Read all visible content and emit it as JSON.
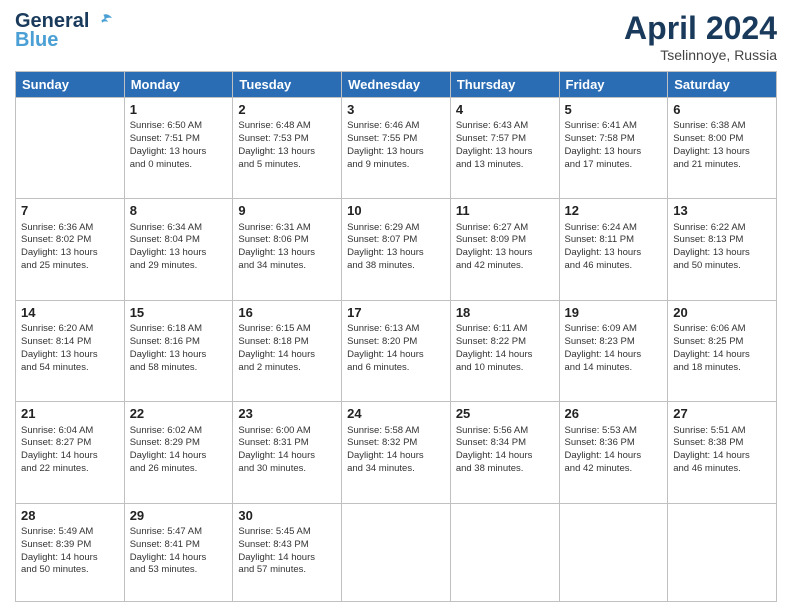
{
  "header": {
    "logo_line1": "General",
    "logo_line2": "Blue",
    "month": "April 2024",
    "location": "Tselinnoye, Russia"
  },
  "days_of_week": [
    "Sunday",
    "Monday",
    "Tuesday",
    "Wednesday",
    "Thursday",
    "Friday",
    "Saturday"
  ],
  "weeks": [
    [
      {
        "day": "",
        "content": ""
      },
      {
        "day": "1",
        "content": "Sunrise: 6:50 AM\nSunset: 7:51 PM\nDaylight: 13 hours\nand 0 minutes."
      },
      {
        "day": "2",
        "content": "Sunrise: 6:48 AM\nSunset: 7:53 PM\nDaylight: 13 hours\nand 5 minutes."
      },
      {
        "day": "3",
        "content": "Sunrise: 6:46 AM\nSunset: 7:55 PM\nDaylight: 13 hours\nand 9 minutes."
      },
      {
        "day": "4",
        "content": "Sunrise: 6:43 AM\nSunset: 7:57 PM\nDaylight: 13 hours\nand 13 minutes."
      },
      {
        "day": "5",
        "content": "Sunrise: 6:41 AM\nSunset: 7:58 PM\nDaylight: 13 hours\nand 17 minutes."
      },
      {
        "day": "6",
        "content": "Sunrise: 6:38 AM\nSunset: 8:00 PM\nDaylight: 13 hours\nand 21 minutes."
      }
    ],
    [
      {
        "day": "7",
        "content": "Sunrise: 6:36 AM\nSunset: 8:02 PM\nDaylight: 13 hours\nand 25 minutes."
      },
      {
        "day": "8",
        "content": "Sunrise: 6:34 AM\nSunset: 8:04 PM\nDaylight: 13 hours\nand 29 minutes."
      },
      {
        "day": "9",
        "content": "Sunrise: 6:31 AM\nSunset: 8:06 PM\nDaylight: 13 hours\nand 34 minutes."
      },
      {
        "day": "10",
        "content": "Sunrise: 6:29 AM\nSunset: 8:07 PM\nDaylight: 13 hours\nand 38 minutes."
      },
      {
        "day": "11",
        "content": "Sunrise: 6:27 AM\nSunset: 8:09 PM\nDaylight: 13 hours\nand 42 minutes."
      },
      {
        "day": "12",
        "content": "Sunrise: 6:24 AM\nSunset: 8:11 PM\nDaylight: 13 hours\nand 46 minutes."
      },
      {
        "day": "13",
        "content": "Sunrise: 6:22 AM\nSunset: 8:13 PM\nDaylight: 13 hours\nand 50 minutes."
      }
    ],
    [
      {
        "day": "14",
        "content": "Sunrise: 6:20 AM\nSunset: 8:14 PM\nDaylight: 13 hours\nand 54 minutes."
      },
      {
        "day": "15",
        "content": "Sunrise: 6:18 AM\nSunset: 8:16 PM\nDaylight: 13 hours\nand 58 minutes."
      },
      {
        "day": "16",
        "content": "Sunrise: 6:15 AM\nSunset: 8:18 PM\nDaylight: 14 hours\nand 2 minutes."
      },
      {
        "day": "17",
        "content": "Sunrise: 6:13 AM\nSunset: 8:20 PM\nDaylight: 14 hours\nand 6 minutes."
      },
      {
        "day": "18",
        "content": "Sunrise: 6:11 AM\nSunset: 8:22 PM\nDaylight: 14 hours\nand 10 minutes."
      },
      {
        "day": "19",
        "content": "Sunrise: 6:09 AM\nSunset: 8:23 PM\nDaylight: 14 hours\nand 14 minutes."
      },
      {
        "day": "20",
        "content": "Sunrise: 6:06 AM\nSunset: 8:25 PM\nDaylight: 14 hours\nand 18 minutes."
      }
    ],
    [
      {
        "day": "21",
        "content": "Sunrise: 6:04 AM\nSunset: 8:27 PM\nDaylight: 14 hours\nand 22 minutes."
      },
      {
        "day": "22",
        "content": "Sunrise: 6:02 AM\nSunset: 8:29 PM\nDaylight: 14 hours\nand 26 minutes."
      },
      {
        "day": "23",
        "content": "Sunrise: 6:00 AM\nSunset: 8:31 PM\nDaylight: 14 hours\nand 30 minutes."
      },
      {
        "day": "24",
        "content": "Sunrise: 5:58 AM\nSunset: 8:32 PM\nDaylight: 14 hours\nand 34 minutes."
      },
      {
        "day": "25",
        "content": "Sunrise: 5:56 AM\nSunset: 8:34 PM\nDaylight: 14 hours\nand 38 minutes."
      },
      {
        "day": "26",
        "content": "Sunrise: 5:53 AM\nSunset: 8:36 PM\nDaylight: 14 hours\nand 42 minutes."
      },
      {
        "day": "27",
        "content": "Sunrise: 5:51 AM\nSunset: 8:38 PM\nDaylight: 14 hours\nand 46 minutes."
      }
    ],
    [
      {
        "day": "28",
        "content": "Sunrise: 5:49 AM\nSunset: 8:39 PM\nDaylight: 14 hours\nand 50 minutes."
      },
      {
        "day": "29",
        "content": "Sunrise: 5:47 AM\nSunset: 8:41 PM\nDaylight: 14 hours\nand 53 minutes."
      },
      {
        "day": "30",
        "content": "Sunrise: 5:45 AM\nSunset: 8:43 PM\nDaylight: 14 hours\nand 57 minutes."
      },
      {
        "day": "",
        "content": ""
      },
      {
        "day": "",
        "content": ""
      },
      {
        "day": "",
        "content": ""
      },
      {
        "day": "",
        "content": ""
      }
    ]
  ]
}
